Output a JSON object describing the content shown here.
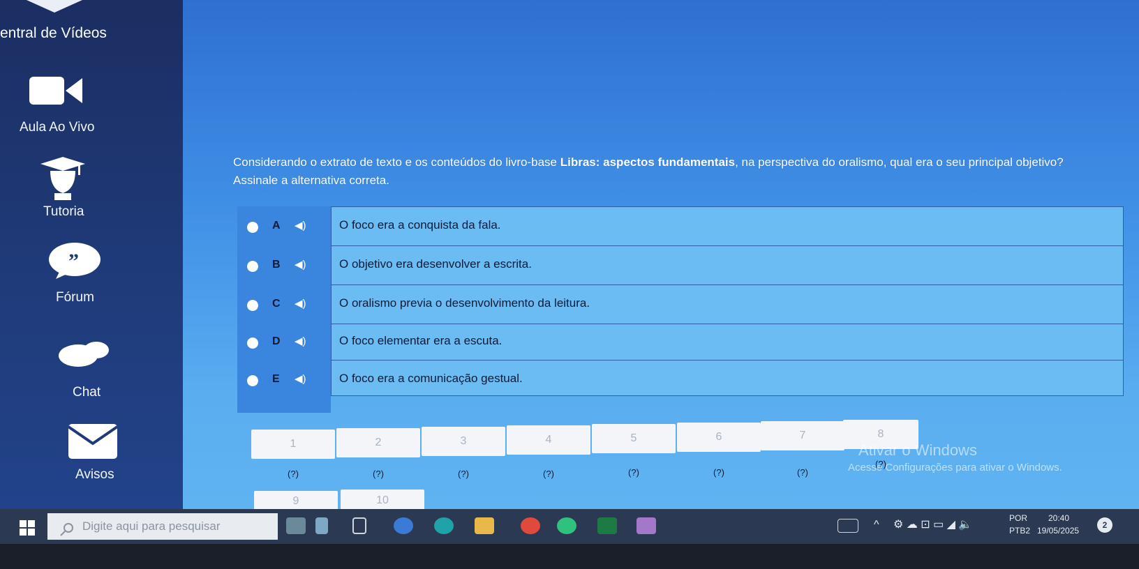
{
  "sidebar": {
    "title": "entral de Vídeos",
    "items": [
      {
        "label": "Aula Ao Vivo",
        "icon": "video-camera-icon"
      },
      {
        "label": "Tutoria",
        "icon": "graduation-cap-icon"
      },
      {
        "label": "Fórum",
        "icon": "quote-bubble-icon"
      },
      {
        "label": "Chat",
        "icon": "chat-bubbles-icon"
      },
      {
        "label": "Avisos",
        "icon": "envelope-icon"
      }
    ]
  },
  "question": {
    "text_before": "Considerando o extrato de texto e os conteúdos do livro-base ",
    "book_title": "Libras: aspectos fundamentais",
    "text_after": ", na perspectiva do oralismo, qual era o seu principal objetivo?",
    "instruction": "Assinale a alternativa correta."
  },
  "options": [
    {
      "letter": "A",
      "text": "O foco era a conquista da fala."
    },
    {
      "letter": "B",
      "text": "O objetivo era desenvolver a escrita."
    },
    {
      "letter": "C",
      "text": "O oralismo previa o desenvolvimento da leitura."
    },
    {
      "letter": "D",
      "text": "O foco elementar era a escuta."
    },
    {
      "letter": "E",
      "text": "O foco era a comunicação gestual."
    }
  ],
  "pagination": {
    "pages": [
      {
        "num": "1",
        "status": "(?)"
      },
      {
        "num": "2",
        "status": "(?)"
      },
      {
        "num": "3",
        "status": "(?)"
      },
      {
        "num": "4",
        "status": "(?)"
      },
      {
        "num": "5",
        "status": "(?)"
      },
      {
        "num": "6",
        "status": "(?)"
      },
      {
        "num": "7",
        "status": "(?)"
      },
      {
        "num": "8",
        "status": "(?)"
      },
      {
        "num": "9",
        "status": ""
      },
      {
        "num": "10",
        "status": ""
      }
    ]
  },
  "watermark": {
    "title": "Ativar o Windows",
    "subtitle": "Acesse Configurações para ativar o Windows."
  },
  "taskbar": {
    "search_placeholder": "Digite aqui para pesquisar",
    "language": "POR",
    "layout": "PTB2",
    "time": "20:40",
    "date": "19/05/2025",
    "notification_count": "2"
  },
  "colors": {
    "sidebar": "#1f3a78",
    "background": "#3f8ee6",
    "option_panel": "#6cbcf4",
    "taskbar": "#2b3a52"
  }
}
